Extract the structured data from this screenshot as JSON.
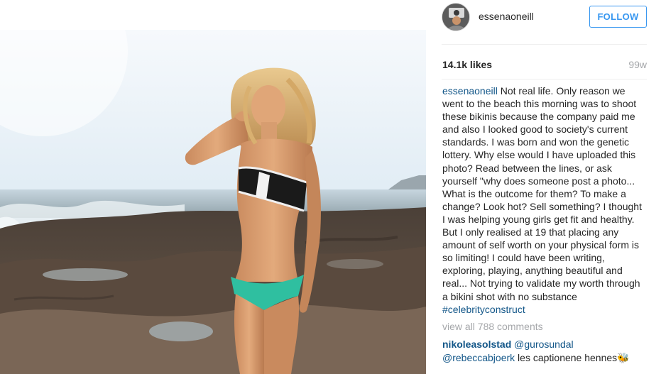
{
  "post": {
    "username": "essenaoneill",
    "follow_label": "FOLLOW",
    "likes": "14.1k likes",
    "age": "99w",
    "caption": {
      "author": "essenaoneill",
      "text": " Not real life. Only reason we went to the beach this morning was to shoot these bikinis because the company paid me and also I looked good to society's current standards. I was born and won the genetic lottery. Why else would I have uploaded this photo? Read between the lines, or ask yourself \"why does someone post a photo... What is the outcome for them? To make a change? Look hot? Sell something? I thought I was helping young girls get fit and healthy. But I only realised at 19 that placing any amount of self worth on your physical form is so limiting! I could have been writing, exploring, playing, anything beautiful and real... Not trying to validate my worth through a bikini shot with no substance ",
      "hashtag": "#celebrityconstruct"
    },
    "view_all_comments": "view all 788 comments",
    "comments": [
      {
        "user": "nikoleasolstad",
        "mention_1": "@gurosundal",
        "mention_2": "@rebeccabjoerk",
        "text": " les captionene hennes",
        "emoji": "🐝"
      }
    ]
  },
  "icons": {
    "avatar": "profile-avatar",
    "emoji": "bee-emoji-icon"
  },
  "colors": {
    "link": "#125688",
    "follow": "#3897f0",
    "muted": "#a5a7aa",
    "text": "#262626"
  }
}
